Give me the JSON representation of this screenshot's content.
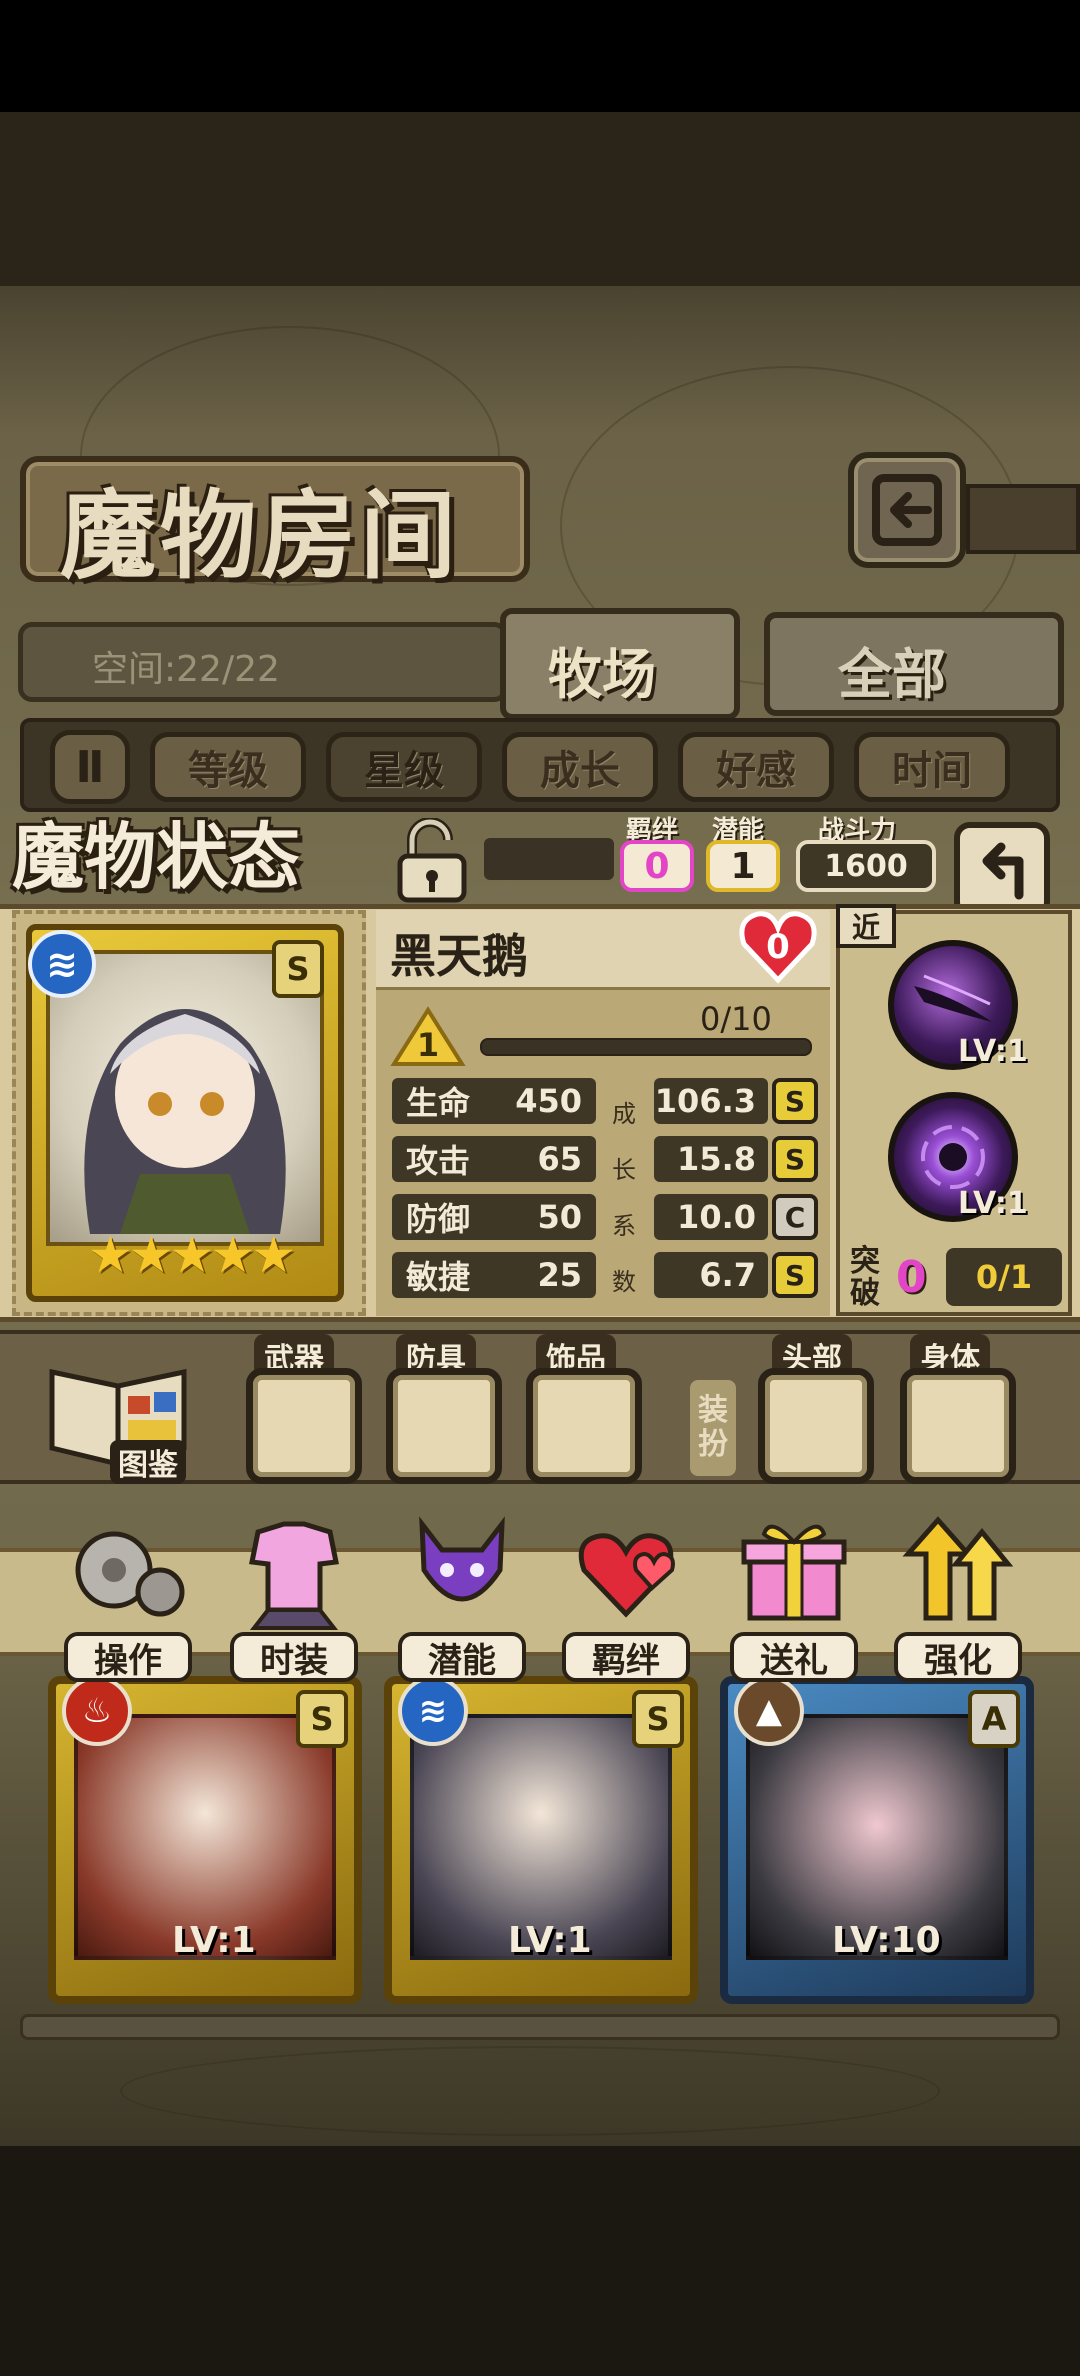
{
  "header": {
    "title": "魔物房间"
  },
  "space": {
    "label": "空间:22/22"
  },
  "tabs": [
    {
      "label": "牧场"
    },
    {
      "label": "全部"
    }
  ],
  "sort": {
    "toggle": "Ⅱ",
    "buttons": [
      "等级",
      "星级",
      "成长",
      "好感",
      "时间"
    ],
    "active_index": 1
  },
  "status": {
    "title": "魔物状态",
    "bond_label": "羁绊",
    "bond_value": "0",
    "potential_label": "潜能",
    "potential_value": "1",
    "power_label": "战斗力",
    "power_value": "1600"
  },
  "monster": {
    "name": "黑天鹅",
    "affection": "0",
    "level": "1",
    "exp_text": "0/10",
    "exp_fraction": 0,
    "element_icon": "water-icon",
    "rank": "S",
    "stars": "★★★★★",
    "star_count": 5,
    "stats": [
      {
        "label": "生命",
        "value": "450",
        "growth": "106.3",
        "grade": "S"
      },
      {
        "label": "攻击",
        "value": "65",
        "growth": "15.8",
        "grade": "S"
      },
      {
        "label": "防御",
        "value": "50",
        "growth": "10.0",
        "grade": "C"
      },
      {
        "label": "敏捷",
        "value": "25",
        "growth": "6.7",
        "grade": "S"
      }
    ],
    "growth_chars": [
      "成",
      "长",
      "系",
      "数"
    ]
  },
  "skills": {
    "tag": "近",
    "items": [
      {
        "lv": "LV:1"
      },
      {
        "lv": "LV:1"
      }
    ],
    "breakthrough_label": "突破",
    "breakthrough_value": "0",
    "breakthrough_progress": "0/1"
  },
  "equipment": {
    "book_label": "图鉴",
    "slots": [
      "武器",
      "防具",
      "饰品",
      "头部",
      "身体"
    ],
    "side_label_1": "装",
    "side_label_2": "扮"
  },
  "actions": [
    "操作",
    "时装",
    "潜能",
    "羁绊",
    "送礼",
    "强化"
  ],
  "cards": [
    {
      "lv": "LV:1",
      "element": "fire",
      "rank": "S"
    },
    {
      "lv": "LV:1",
      "element": "water",
      "rank": "S"
    },
    {
      "lv": "LV:10",
      "element": "earth",
      "rank": "A"
    }
  ]
}
